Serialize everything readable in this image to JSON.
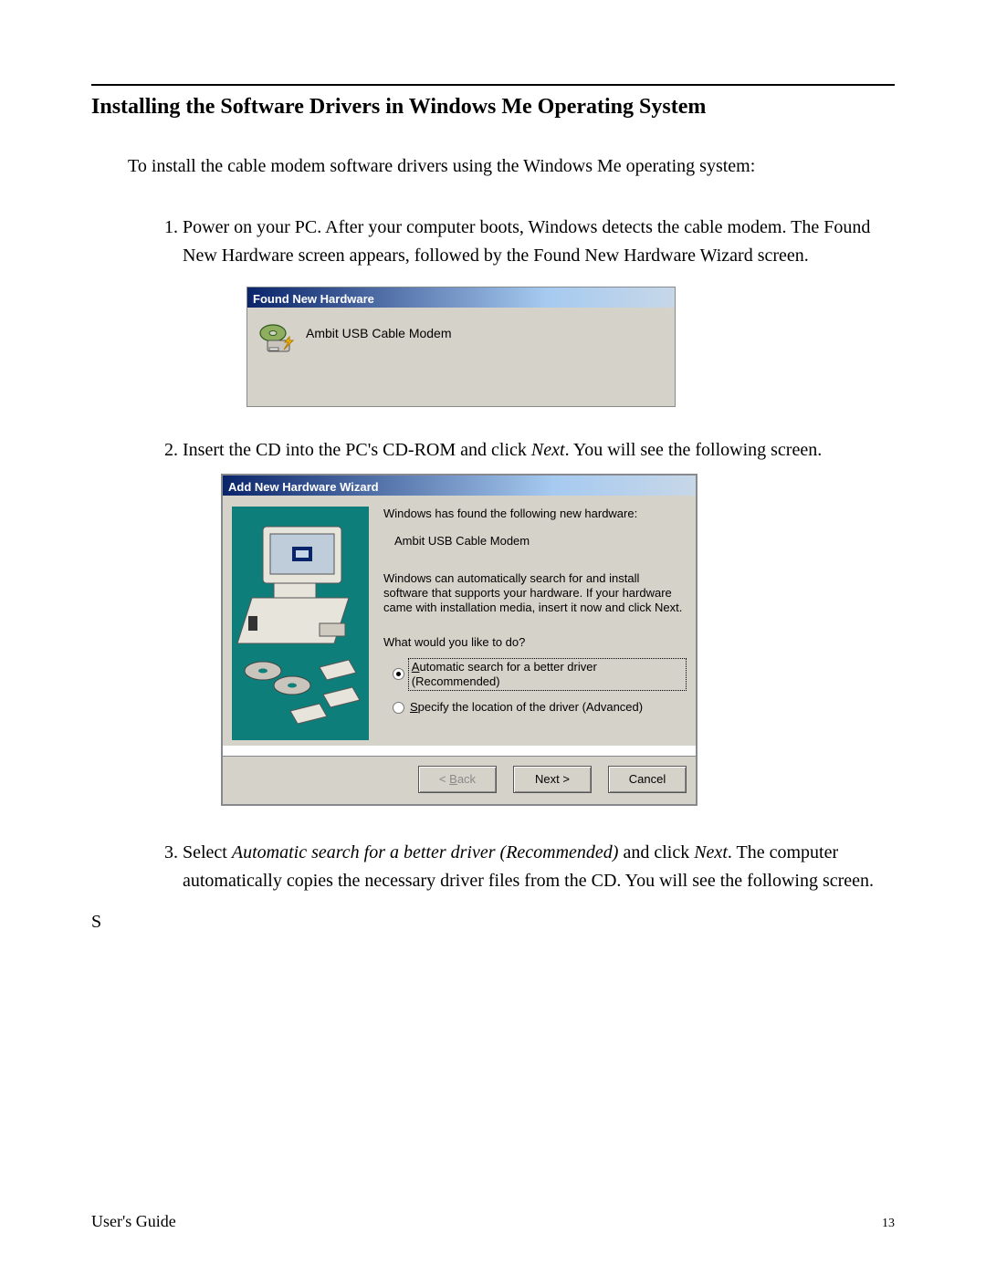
{
  "heading": "Installing the Software Drivers in Windows Me Operating System",
  "intro": "To install the cable modem software drivers using the Windows Me operating system:",
  "steps": {
    "s1": "Power on your PC.  After your computer boots, Windows detects the cable modem.  The Found New Hardware screen appears, followed by the Found New Hardware Wizard screen.",
    "s2_pre": "Insert the CD into the PC's CD-ROM and click ",
    "s2_ital": "Next",
    "s2_post": ".  You will see the following screen.",
    "s3_pre": "Select ",
    "s3_ital": "Automatic search for a better driver (Recommended)",
    "s3_mid": " and click ",
    "s3_ital2": "Next",
    "s3_post": ".  The computer automatically copies the necessary driver files from the CD.  You will see the following screen."
  },
  "stray": "S",
  "dialog1": {
    "title": "Found New Hardware",
    "device": "Ambit USB Cable Modem"
  },
  "dialog2": {
    "title": "Add New Hardware Wizard",
    "line1": "Windows has found the following new hardware:",
    "device": "Ambit USB Cable Modem",
    "desc": "Windows can automatically search for and install software that supports your hardware. If your hardware came with installation media, insert it now and click Next.",
    "question": "What would you like to do?",
    "opt1_accel": "A",
    "opt1_rest": "utomatic search for a better driver (Recommended)",
    "opt2_accel": "S",
    "opt2_rest": "pecify the location of the driver (Advanced)",
    "back_lt": "< ",
    "back_accel": "B",
    "back_rest": "ack",
    "next": "Next >",
    "cancel": "Cancel"
  },
  "footer": {
    "guide": "User's Guide",
    "page": "13"
  }
}
